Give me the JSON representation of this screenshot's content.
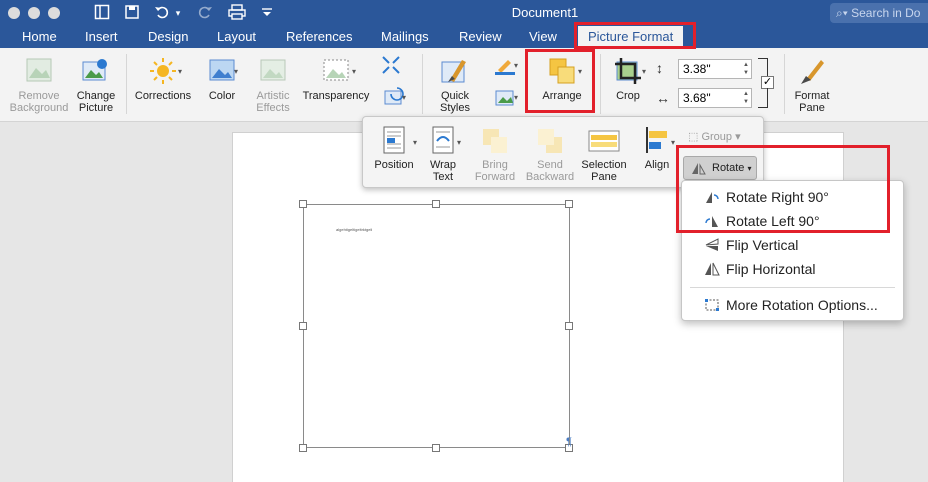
{
  "window": {
    "title": "Document1",
    "search_placeholder": "Search in Do"
  },
  "tabs": [
    "Home",
    "Insert",
    "Design",
    "Layout",
    "References",
    "Mailings",
    "Review",
    "View",
    "Picture Format"
  ],
  "active_tab": "Picture Format",
  "ribbon": {
    "remove_background": [
      "Remove",
      "Background"
    ],
    "change_picture": [
      "Change",
      "Picture"
    ],
    "corrections": "Corrections",
    "color": "Color",
    "artistic_effects": [
      "Artistic",
      "Effects"
    ],
    "transparency": "Transparency",
    "quick_styles": [
      "Quick",
      "Styles"
    ],
    "arrange": "Arrange",
    "crop": "Crop",
    "height_value": "3.38\"",
    "width_value": "3.68\"",
    "format_pane": [
      "Format",
      "Pane"
    ]
  },
  "arrange_popup": {
    "position": "Position",
    "wrap_text": [
      "Wrap",
      "Text"
    ],
    "bring_forward": [
      "Bring",
      "Forward"
    ],
    "send_backward": [
      "Send",
      "Backward"
    ],
    "selection_pane": [
      "Selection",
      "Pane"
    ],
    "align": "Align",
    "group": "Group",
    "rotate": "Rotate"
  },
  "rotate_menu": [
    "Rotate Right 90°",
    "Rotate Left 90°",
    "Flip Vertical",
    "Flip Horizontal",
    "More Rotation Options..."
  ],
  "document": {
    "tiny_text": "algehtigeltigeltrktgeli",
    "pilcrow": "¶"
  },
  "colors": {
    "brand": "#2b579a",
    "highlight": "#e2202b",
    "popup_bg": "#f4f4f4"
  },
  "icons": [
    "undo-icon",
    "redo-icon",
    "save-icon",
    "print-icon",
    "search-icon",
    "rotate-icon",
    "flip-vertical-icon",
    "flip-horizontal-icon"
  ]
}
